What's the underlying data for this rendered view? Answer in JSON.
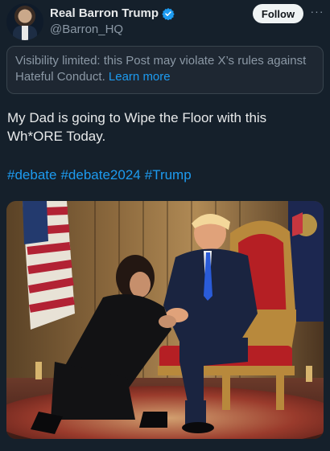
{
  "author": {
    "name": "Real Barron Trump",
    "handle": "@Barron_HQ",
    "verified_icon": "verified-badge-icon"
  },
  "actions": {
    "follow_label": "Follow",
    "more_label": "···"
  },
  "notice": {
    "text": "Visibility limited: this Post may violate X’s rules against Hateful Conduct.",
    "link_label": "Learn more"
  },
  "post": {
    "text_line1": "My Dad is going to Wipe the Floor with this",
    "text_line2": "Wh*ORE Today.",
    "hashtags": [
      "#debate",
      "#debate2024",
      "#Trump"
    ]
  },
  "media": {
    "image_description_icon": "photo-image"
  },
  "colors": {
    "background": "#15202b",
    "accent": "#1d9bf0",
    "muted": "#8b98a5",
    "text": "#e7e9ea",
    "notice_bg": "#1e2732"
  }
}
